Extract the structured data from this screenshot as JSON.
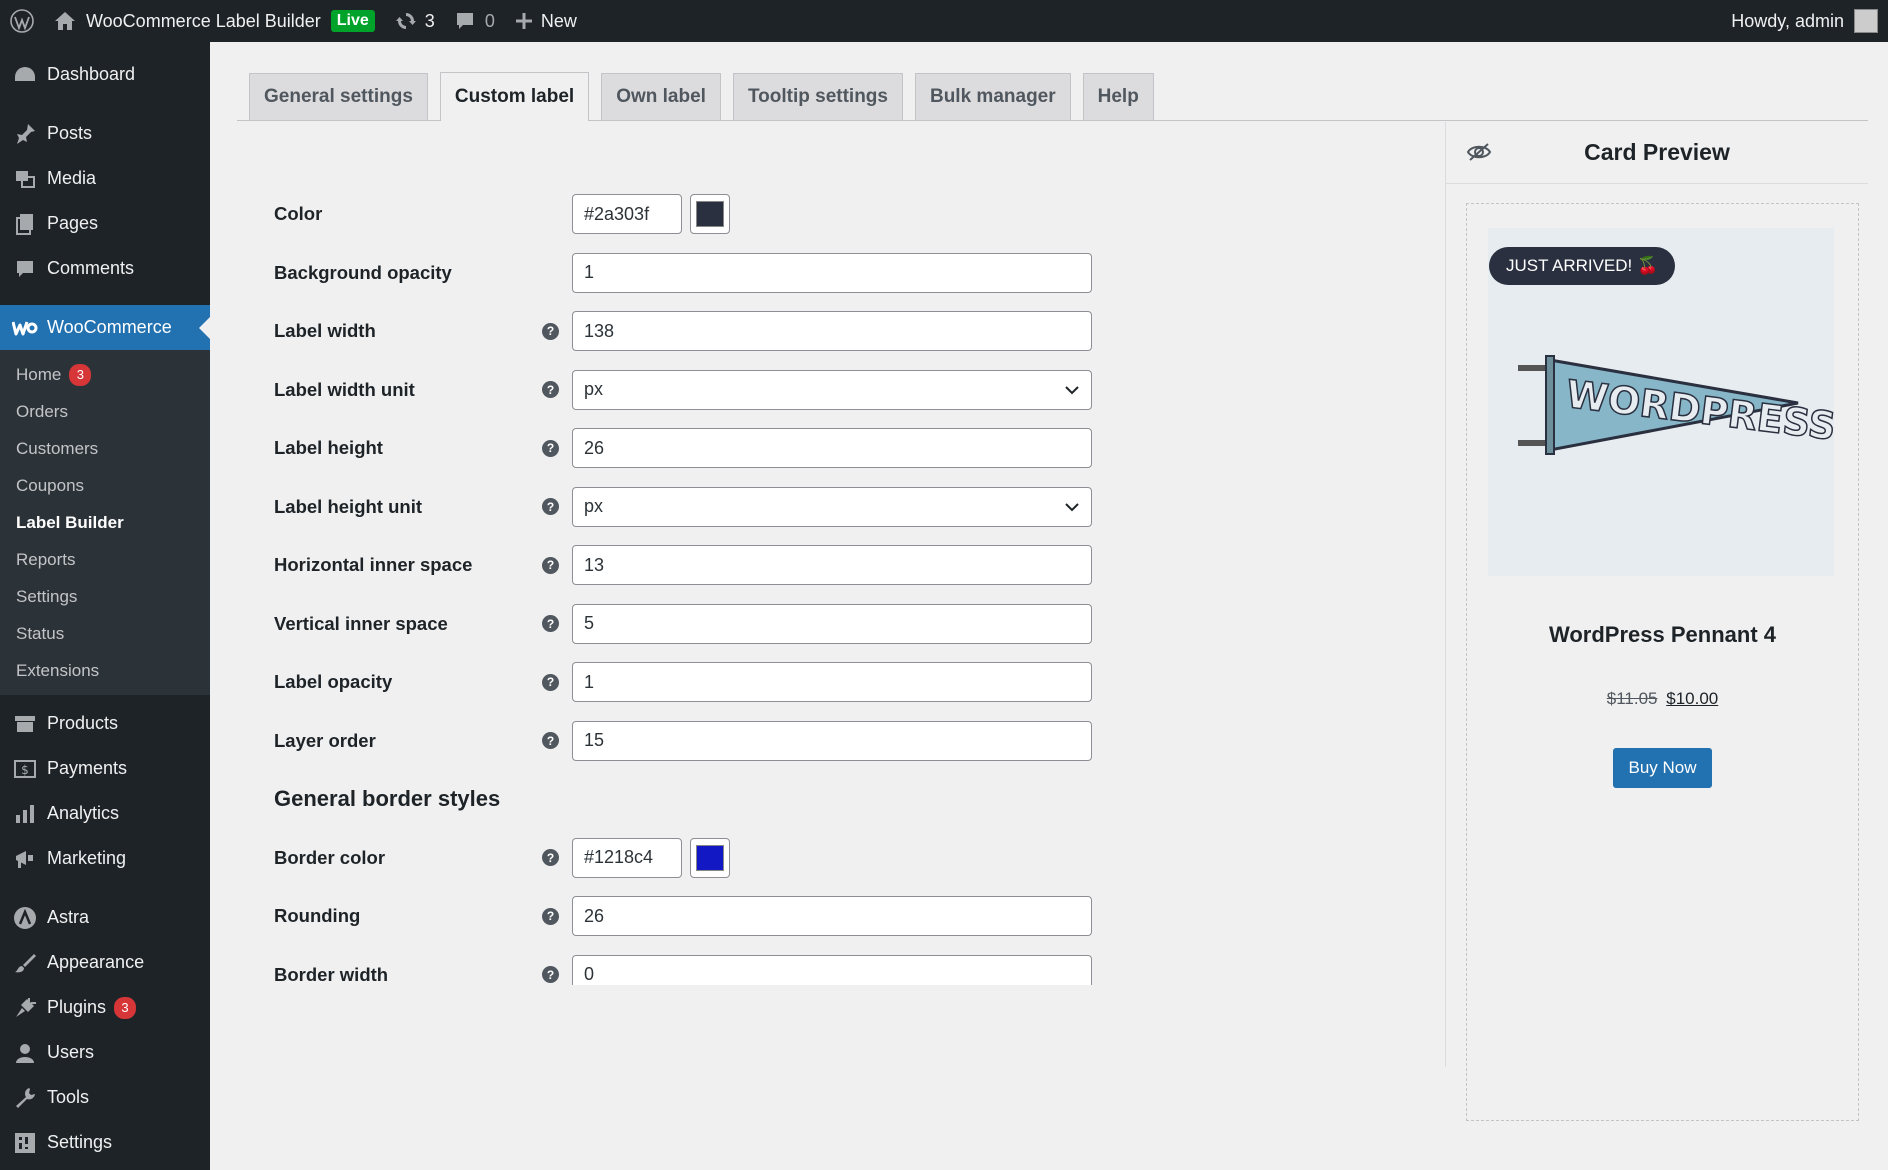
{
  "adminbar": {
    "site_name": "WooCommerce Label Builder",
    "live_badge": "Live",
    "updates_count": "3",
    "comments_count": "0",
    "new_label": "New",
    "howdy": "Howdy, admin"
  },
  "sidebar": {
    "dashboard": "Dashboard",
    "posts": "Posts",
    "media": "Media",
    "pages": "Pages",
    "comments": "Comments",
    "woocommerce": "WooCommerce",
    "woo_sub": {
      "home": "Home",
      "home_badge": "3",
      "orders": "Orders",
      "customers": "Customers",
      "coupons": "Coupons",
      "label_builder": "Label Builder",
      "reports": "Reports",
      "settings": "Settings",
      "status": "Status",
      "extensions": "Extensions"
    },
    "products": "Products",
    "payments": "Payments",
    "analytics": "Analytics",
    "marketing": "Marketing",
    "astra": "Astra",
    "appearance": "Appearance",
    "plugins": "Plugins",
    "plugins_badge": "3",
    "users": "Users",
    "tools": "Tools",
    "settings": "Settings"
  },
  "tabs": [
    {
      "label": "General settings"
    },
    {
      "label": "Custom label"
    },
    {
      "label": "Own label"
    },
    {
      "label": "Tooltip settings"
    },
    {
      "label": "Bulk manager"
    },
    {
      "label": "Help"
    }
  ],
  "form": {
    "color": {
      "label": "Color",
      "value": "#2a303f"
    },
    "background_opacity": {
      "label": "Background opacity",
      "value": "1"
    },
    "label_width": {
      "label": "Label width",
      "value": "138"
    },
    "label_width_unit": {
      "label": "Label width unit",
      "value": "px"
    },
    "label_height": {
      "label": "Label height",
      "value": "26"
    },
    "label_height_unit": {
      "label": "Label height unit",
      "value": "px"
    },
    "horizontal_inner_space": {
      "label": "Horizontal inner space",
      "value": "13"
    },
    "vertical_inner_space": {
      "label": "Vertical inner space",
      "value": "5"
    },
    "label_opacity": {
      "label": "Label opacity",
      "value": "1"
    },
    "layer_order": {
      "label": "Layer order",
      "value": "15"
    },
    "border_section_title": "General border styles",
    "border_color": {
      "label": "Border color",
      "value": "#1218c4"
    },
    "rounding": {
      "label": "Rounding",
      "value": "26"
    },
    "border_width": {
      "label": "Border width",
      "value": "0"
    }
  },
  "preview": {
    "title": "Card Preview",
    "label_text": "JUST ARRIVED! 🍒",
    "product_name": "WordPress Pennant 4",
    "old_price": "$11.05",
    "new_price": "$10.00",
    "buy_label": "Buy Now",
    "pennant_text": "WORDPRESS"
  },
  "colors": {
    "accent": "#2271b1",
    "label_color": "#2a303f",
    "border_color": "#1218c4"
  }
}
